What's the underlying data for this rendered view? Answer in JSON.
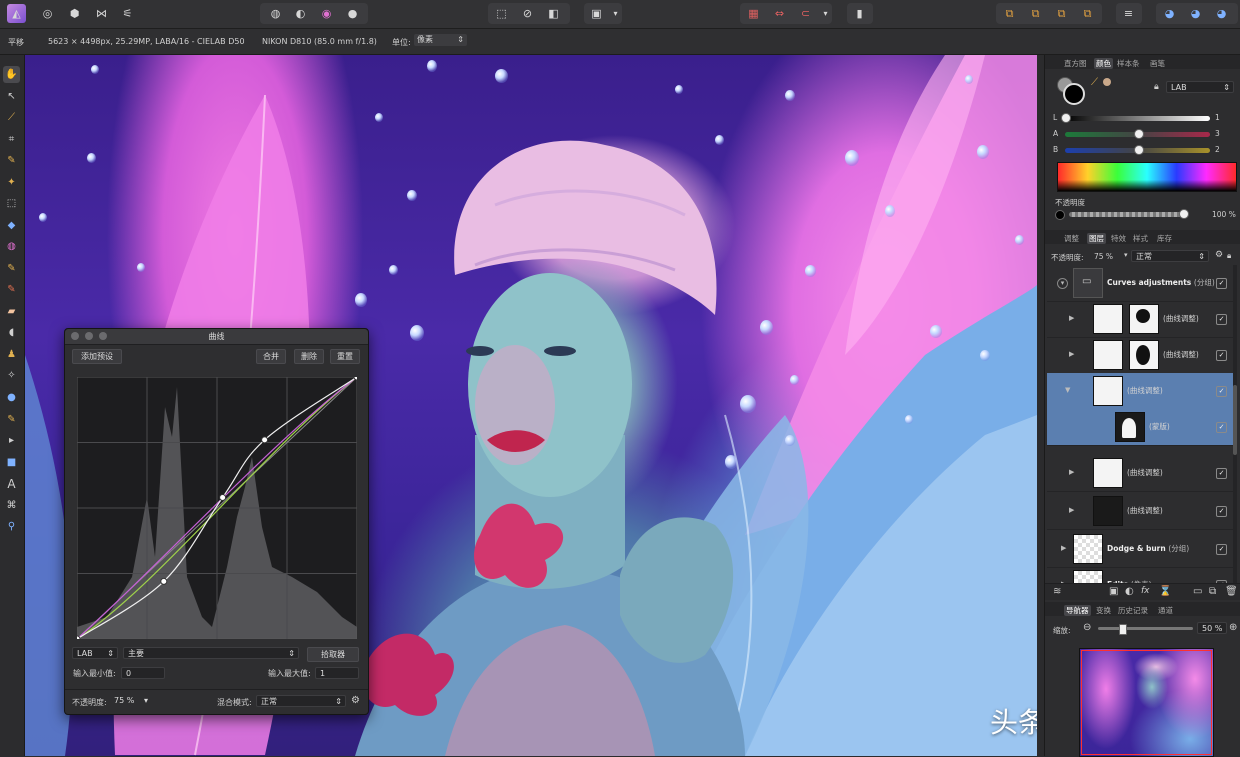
{
  "toolbar": {
    "app_icon": "affinity-photo-icon",
    "persona_icons": [
      "photo-persona-icon",
      "liquify-persona-icon",
      "develop-persona-icon",
      "tone-mapping-persona-icon",
      "export-persona-icon"
    ],
    "color_tools": [
      "color-wheel-icon",
      "contrast-icon",
      "hue-icon",
      "white-balance-icon"
    ],
    "accent": "#b07cd8"
  },
  "context": {
    "tool": "平移",
    "doc_info": "5623 × 4498px, 25.29MP, LABA/16 - CIELAB D50",
    "camera": "NIKON D810 (85.0 mm f/1.8)",
    "unit_label": "单位:",
    "unit_value": "像素"
  },
  "curves": {
    "title": "曲线",
    "add_preset": "添加预设",
    "merge": "合并",
    "delete": "删除",
    "reset": "重置",
    "color_space": "LAB",
    "channel": "主要",
    "picker": "拾取器",
    "input_min_label": "输入最小值:",
    "input_min_value": "0",
    "input_max_label": "输入最大值:",
    "input_max_value": "1",
    "opacity_label": "不透明度:",
    "opacity_value": "75 %",
    "blend_label": "混合模式:",
    "blend_value": "正常",
    "curve_points": [
      [
        0,
        0
      ],
      [
        0.31,
        0.22
      ],
      [
        0.52,
        0.54
      ],
      [
        0.67,
        0.76
      ],
      [
        1,
        1
      ]
    ]
  },
  "color_panel": {
    "tabs": [
      "直方图",
      "颜色",
      "样本条",
      "画笔"
    ],
    "active_tab": "颜色",
    "model": "LAB",
    "channels": [
      {
        "label": "L",
        "value": "1",
        "fraction": 0.0
      },
      {
        "label": "A",
        "value": "3",
        "fraction": 0.5
      },
      {
        "label": "B",
        "value": "2",
        "fraction": 0.5
      }
    ],
    "opacity_label": "不透明度",
    "opacity_value": "100 %"
  },
  "layers_panel": {
    "tabs": [
      "调整",
      "图层",
      "特效",
      "样式",
      "库存"
    ],
    "active_tab": "图层",
    "opacity_label": "不透明度:",
    "opacity_value": "75 %",
    "blend_value": "正常",
    "layers": [
      {
        "name": "Curves adjustments",
        "suffix": "(分组)",
        "bold": true,
        "kind": "group"
      },
      {
        "name": "(曲线调整)",
        "kind": "curve-mask"
      },
      {
        "name": "(曲线调整)",
        "kind": "curve-mask2"
      },
      {
        "name": "(曲线调整)",
        "kind": "curve",
        "selected": true
      },
      {
        "name": "(蒙版)",
        "kind": "mask",
        "selected": true
      },
      {
        "name": "(曲线调整)",
        "kind": "curve"
      },
      {
        "name": "(曲线调整)",
        "kind": "curve-dark"
      },
      {
        "name": "Dodge & burn",
        "suffix": "(分组)",
        "bold": true,
        "kind": "checker"
      },
      {
        "name": "Edits",
        "suffix": "(像素)",
        "bold": true,
        "kind": "checker"
      }
    ]
  },
  "navigator_panel": {
    "tabs": [
      "导航器",
      "变换",
      "历史记录",
      "通道"
    ],
    "active_tab": "导航器",
    "zoom_label": "缩放:",
    "zoom_value": "50 %",
    "zoom_fraction": 0.25
  },
  "watermark": "头条 @如何如何"
}
